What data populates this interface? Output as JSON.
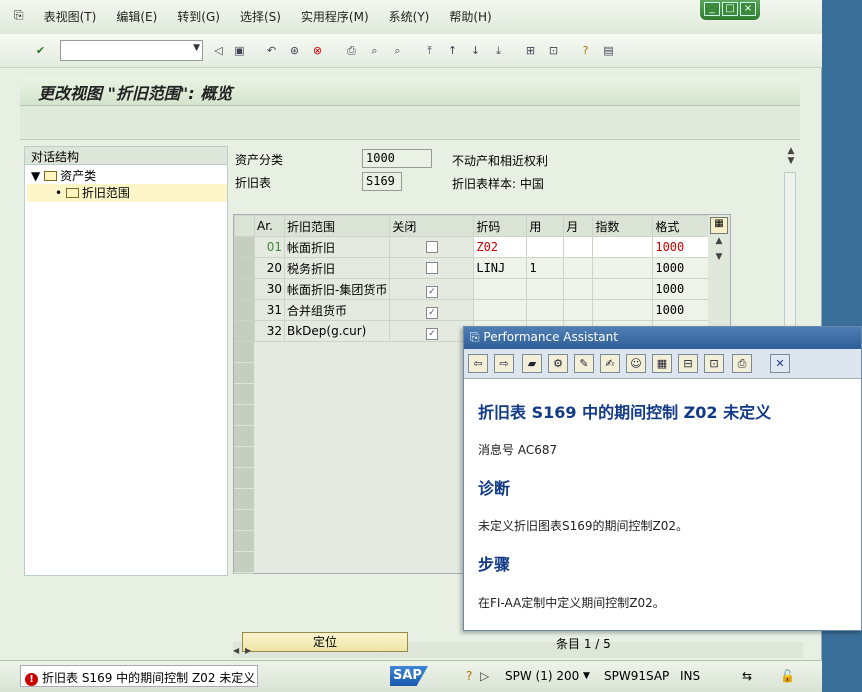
{
  "menu": {
    "items": [
      "表视图(T)",
      "编辑(E)",
      "转到(G)",
      "选择(S)",
      "实用程序(M)",
      "系统(Y)",
      "帮助(H)"
    ]
  },
  "window_controls": [
    "_",
    "□",
    "×"
  ],
  "screen": {
    "title": "更改视图 \"折旧范围\": 概览"
  },
  "tree": {
    "header": "对话结构",
    "root": "资产类",
    "child": "折旧范围"
  },
  "fields": {
    "asset_class_label": "资产分类",
    "asset_class_value": "1000",
    "asset_class_desc": "不动产和相近权利",
    "chart_label": "折旧表",
    "chart_value": "S169",
    "chart_desc": "折旧表样本: 中国"
  },
  "table": {
    "headers": [
      "Ar.",
      "折旧范围",
      "关闭",
      "折码",
      "用",
      "月",
      "指数",
      "格式"
    ],
    "rows": [
      {
        "ar": "01",
        "name": "帐面折旧",
        "closed": false,
        "key": "Z02",
        "use": "",
        "month": "",
        "index": "",
        "fmt": "1000"
      },
      {
        "ar": "20",
        "name": "税务折旧",
        "closed": false,
        "key": "LINJ",
        "use": "1",
        "month": "",
        "index": "",
        "fmt": "1000"
      },
      {
        "ar": "30",
        "name": "帐面折旧-集团货币",
        "closed": true,
        "key": "",
        "use": "",
        "month": "",
        "index": "",
        "fmt": "1000"
      },
      {
        "ar": "31",
        "name": "合并组货币",
        "closed": true,
        "key": "",
        "use": "",
        "month": "",
        "index": "",
        "fmt": "1000"
      },
      {
        "ar": "32",
        "name": "BkDep(g.cur)",
        "closed": true,
        "key": "",
        "use": "",
        "month": "",
        "index": "",
        "fmt": ""
      }
    ]
  },
  "bottom": {
    "button_label": "定位",
    "entry_label": "条目 1 / 5"
  },
  "assistant": {
    "title": "Performance Assistant",
    "heading": "折旧表  S169 中的期间控制  Z02 未定义",
    "msg_no": "消息号  AC687",
    "diag_title": "诊断",
    "diag_text": "未定义折旧图表S169的期间控制Z02。",
    "steps_title": "步骤",
    "steps_text": "在FI-AA定制中定义期间控制Z02。"
  },
  "status": {
    "message": "折旧表 S169 中的期间控制 Z02 未定义",
    "logo": "SAP",
    "session": "SPW (1) 200",
    "server": "SPW91SAP",
    "mode": "INS"
  }
}
